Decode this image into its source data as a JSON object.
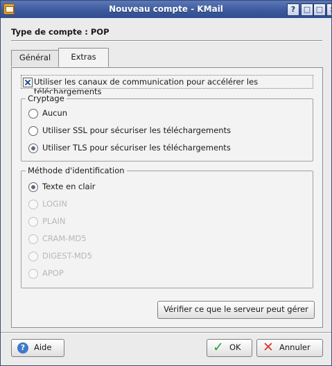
{
  "window": {
    "title": "Nouveau compte - KMail",
    "controls": {
      "help": "?",
      "minimize": "□",
      "maximize": "□",
      "close": "×"
    }
  },
  "header": {
    "account_type": "Type de compte : POP"
  },
  "tabs": [
    {
      "label": "Général"
    },
    {
      "label": "Extras"
    }
  ],
  "extras": {
    "pipelining_label": "Utiliser les canaux de communication pour accélérer les téléchargements",
    "pipelining_checked": true,
    "encryption": {
      "title": "Cryptage",
      "options": [
        {
          "label": "Aucun",
          "selected": false
        },
        {
          "label": "Utiliser SSL pour sécuriser les téléchargements",
          "selected": false
        },
        {
          "label": "Utiliser TLS pour sécuriser les téléchargements",
          "selected": true
        }
      ]
    },
    "auth": {
      "title": "Méthode d'identification",
      "options": [
        {
          "label": "Texte en clair",
          "selected": true,
          "enabled": true
        },
        {
          "label": "LOGIN",
          "selected": false,
          "enabled": false
        },
        {
          "label": "PLAIN",
          "selected": false,
          "enabled": false
        },
        {
          "label": "CRAM-MD5",
          "selected": false,
          "enabled": false
        },
        {
          "label": "DIGEST-MD5",
          "selected": false,
          "enabled": false
        },
        {
          "label": "APOP",
          "selected": false,
          "enabled": false
        }
      ]
    },
    "verify_button": "Vérifier ce que le serveur peut gérer"
  },
  "footer": {
    "help": "Aide",
    "ok": "OK",
    "cancel": "Annuler"
  }
}
